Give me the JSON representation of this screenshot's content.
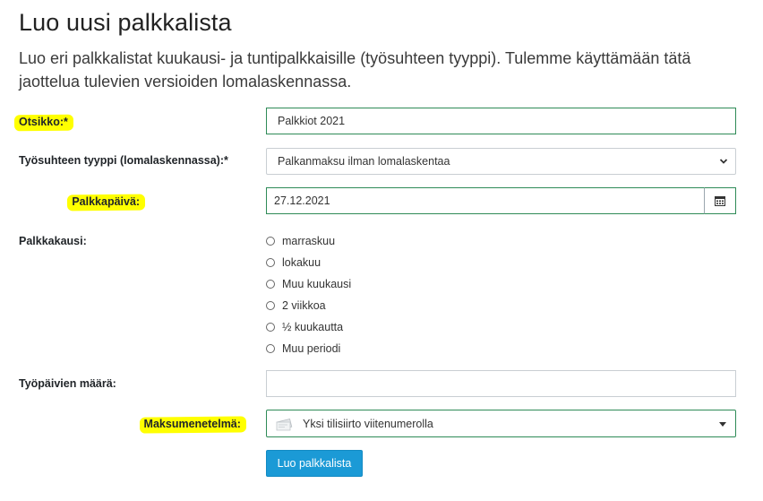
{
  "page": {
    "title": "Luo uusi palkkalista",
    "intro": "Luo eri palkkalistat kuukausi- ja tuntipalkkaisille (työsuhteen tyyppi). Tulemme käyttämään tätä jaottelua tulevien versioiden lomalaskennassa."
  },
  "form": {
    "title_label": "Otsikko:*",
    "title_value": "Palkkiot 2021",
    "employment_label": "Työsuhteen tyyppi (lomalaskennassa):*",
    "employment_value": "Palkanmaksu ilman lomalaskentaa",
    "payday_label": "Palkkapäivä:",
    "payday_value": "27.12.2021",
    "period_label": "Palkkakausi:",
    "period_options": [
      "marraskuu",
      "lokakuu",
      "Muu kuukausi",
      "2 viikkoa",
      "½ kuukautta",
      "Muu periodi"
    ],
    "workdays_label": "Työpäivien määrä:",
    "workdays_value": "",
    "payment_label": "Maksumenetelmä:",
    "payment_value": "Yksi tilisiirto viitenumerolla",
    "submit_label": "Luo palkkalista"
  },
  "icons": {
    "calendar": "calendar-icon",
    "select_arrow": "chevron-down-icon",
    "payment": "payment-transfer-icon",
    "dropdown": "caret-down-icon"
  },
  "colors": {
    "highlight": "#ffff00",
    "focus_border": "#2e8b57",
    "button": "#1b9ad6"
  }
}
